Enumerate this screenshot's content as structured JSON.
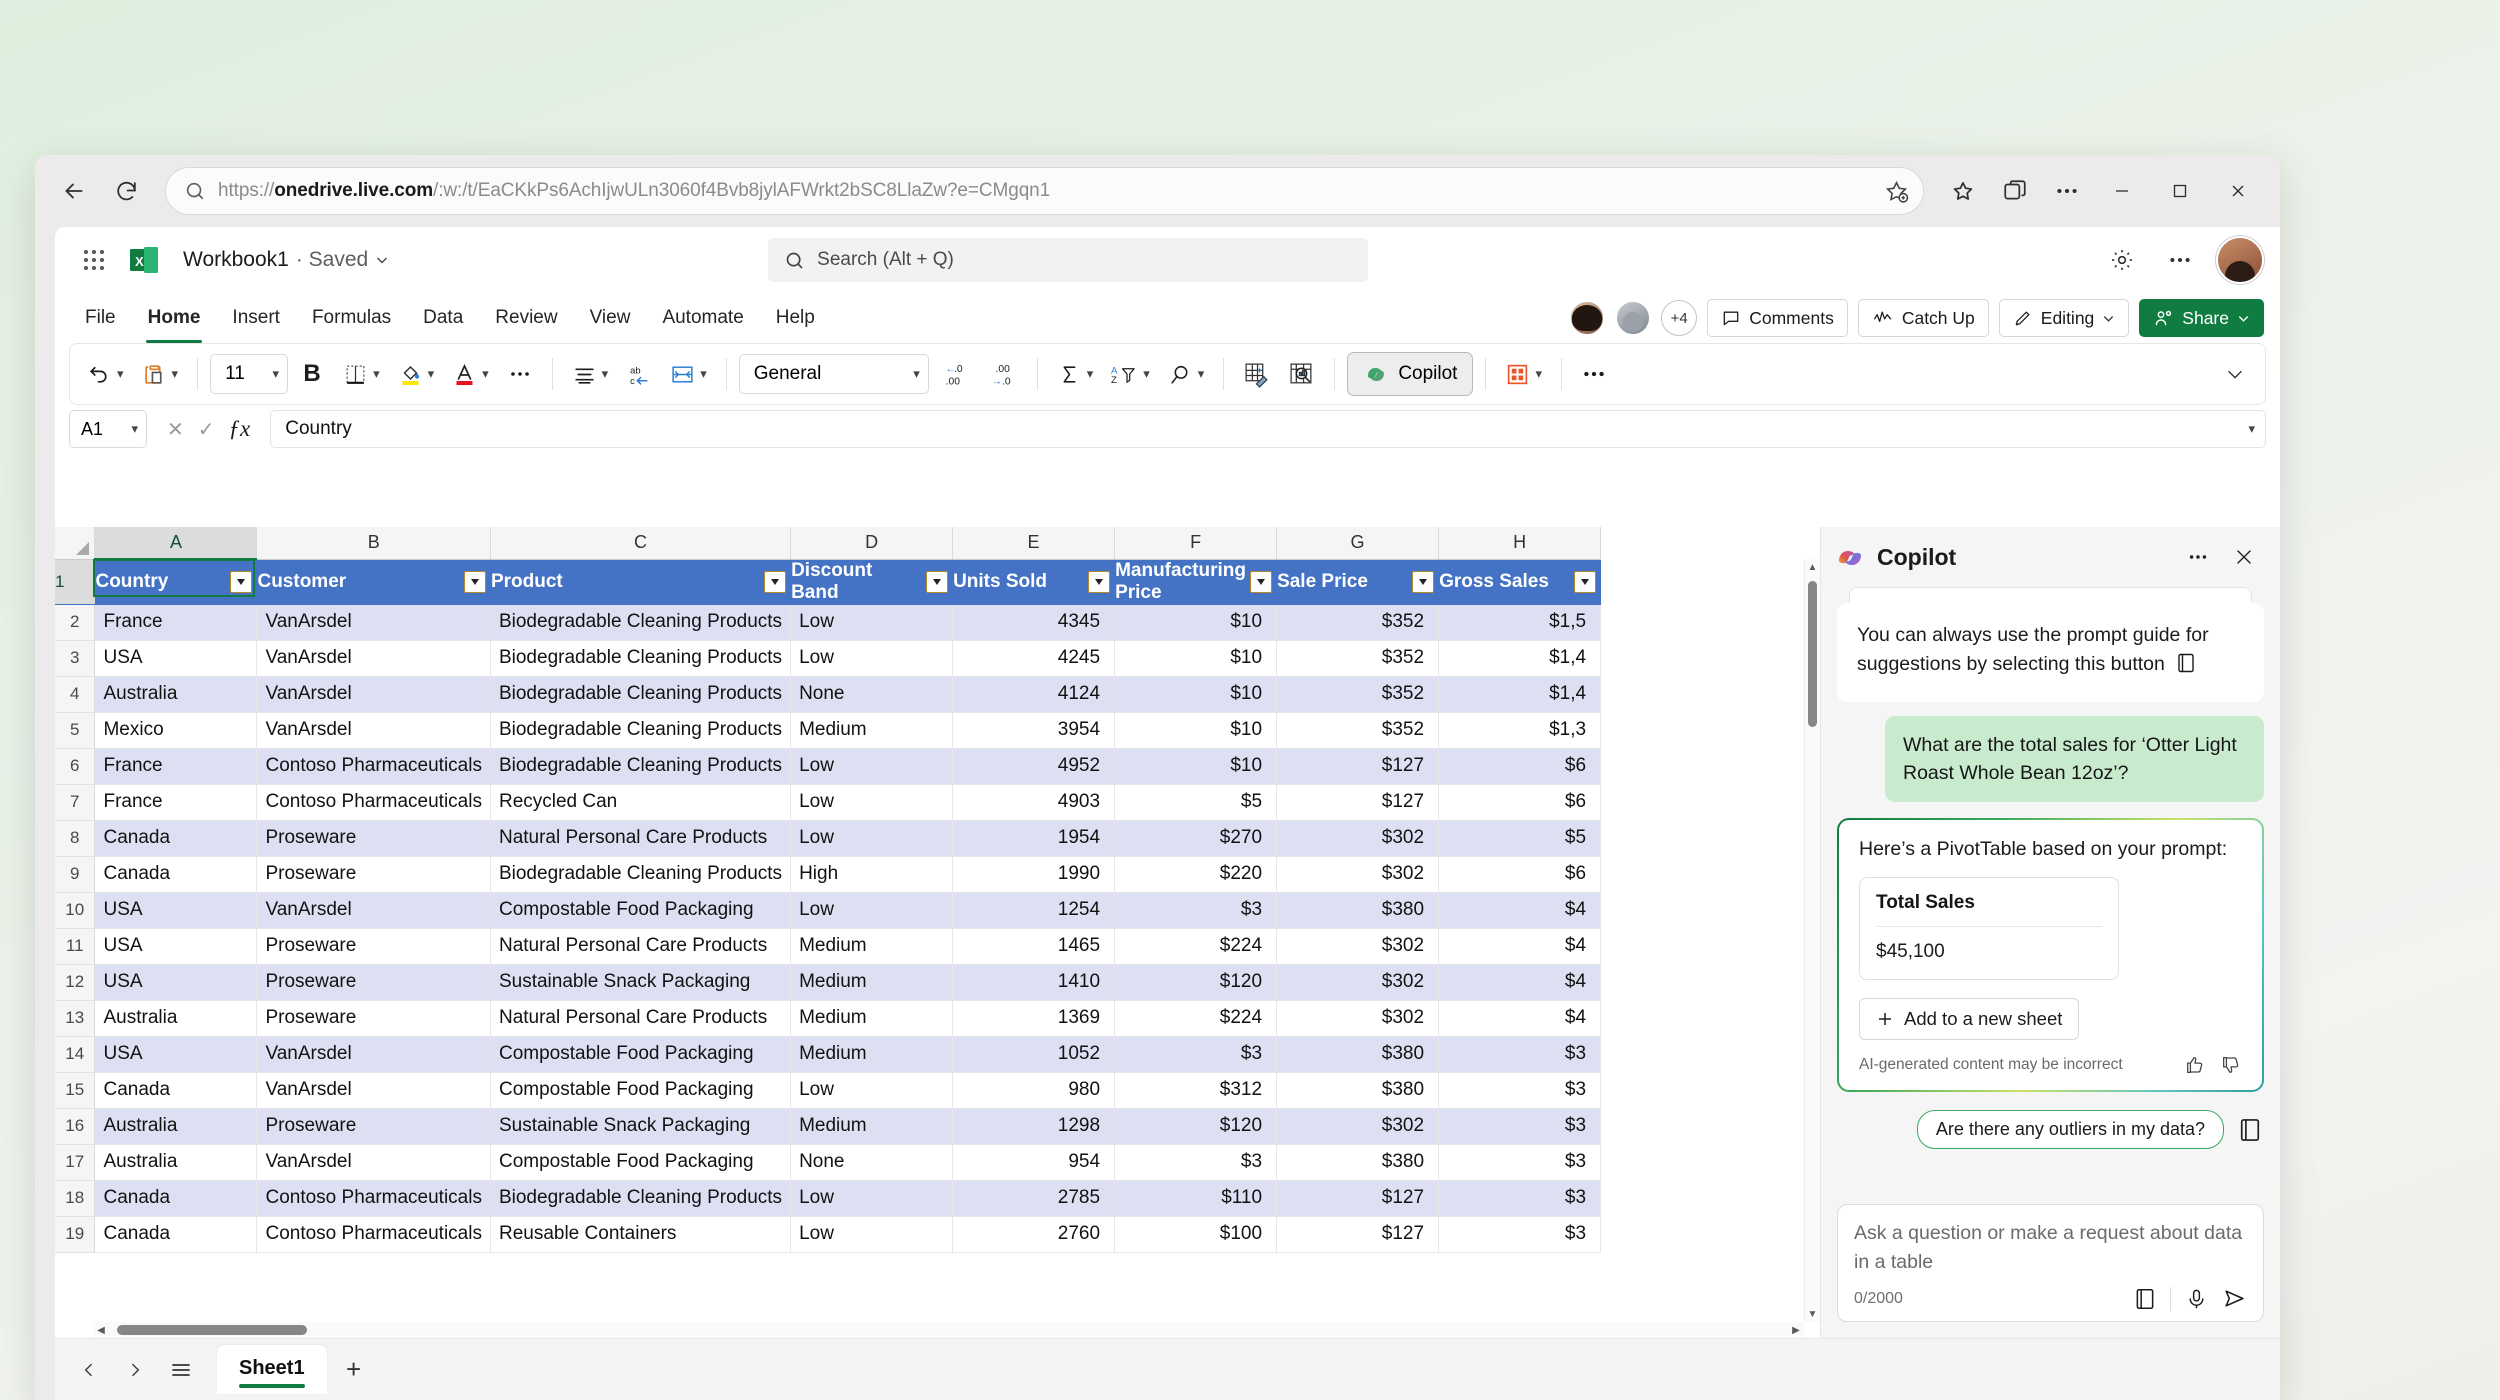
{
  "browser": {
    "url_prefix": "https://",
    "url_domain": "onedrive.live.com",
    "url_path": "/:w:/t/EaCKkPs6AchIjwULn3060f4Bvb8jylAFWrkt2bSC8LlaZw?e=CMgqn1",
    "back_icon": "back-arrow-icon",
    "reload_icon": "reload-icon",
    "search_icon": "search-icon",
    "favorite_icon": "add-favorite-icon",
    "collections_icon": "collections-icon",
    "split_icon": "browser-essentials-icon",
    "more_icon": "more-options-icon",
    "minimize": "–",
    "maximize": "□",
    "close": "✕"
  },
  "app": {
    "waffle": "app-launcher",
    "workbook_name": "Workbook1",
    "saved_status": "· Saved",
    "title_caret": "⌄",
    "search_placeholder": "Search (Alt + Q)",
    "settings_icon": "gear-icon",
    "more_icon": "more-options-icon",
    "avatar": "account-avatar"
  },
  "ribbon": {
    "tabs": [
      {
        "label": "File",
        "active": false
      },
      {
        "label": "Home",
        "active": true
      },
      {
        "label": "Insert",
        "active": false
      },
      {
        "label": "Formulas",
        "active": false
      },
      {
        "label": "Data",
        "active": false
      },
      {
        "label": "Review",
        "active": false
      },
      {
        "label": "View",
        "active": false
      },
      {
        "label": "Automate",
        "active": false
      },
      {
        "label": "Help",
        "active": false
      }
    ],
    "collab_overflow": "+4",
    "comments_label": "Comments",
    "catchup_label": "Catch Up",
    "editing_label": "Editing",
    "share_label": "Share",
    "font_size": "11",
    "bold_label": "B",
    "number_format": "General",
    "copilot_label": "Copilot",
    "collapse_icon": "chevron-down-icon"
  },
  "formula_bar": {
    "name_box": "A1",
    "cancel_icon": "cancel-icon",
    "confirm_icon": "confirm-icon",
    "fx_icon": "fx",
    "value": "Country",
    "expand_icon": "chevron-down-icon"
  },
  "grid": {
    "columns": [
      "A",
      "B",
      "C",
      "D",
      "E",
      "F",
      "G",
      "H"
    ],
    "selected_column": "A",
    "selected_row": "1",
    "headers": [
      "Country",
      "Customer",
      "Product",
      "Discount Band",
      "Units Sold",
      "Manufacturing Price",
      "Sale Price",
      "Gross Sales"
    ],
    "rows": [
      {
        "n": "2",
        "cells": [
          "France",
          "VanArsdel",
          "Biodegradable Cleaning Products",
          "Low",
          "4345",
          "$10",
          "$352",
          "$1,5"
        ]
      },
      {
        "n": "3",
        "cells": [
          "USA",
          "VanArsdel",
          "Biodegradable Cleaning Products",
          "Low",
          "4245",
          "$10",
          "$352",
          "$1,4"
        ]
      },
      {
        "n": "4",
        "cells": [
          "Australia",
          "VanArsdel",
          "Biodegradable Cleaning Products",
          "None",
          "4124",
          "$10",
          "$352",
          "$1,4"
        ]
      },
      {
        "n": "5",
        "cells": [
          "Mexico",
          "VanArsdel",
          "Biodegradable Cleaning Products",
          "Medium",
          "3954",
          "$10",
          "$352",
          "$1,3"
        ]
      },
      {
        "n": "6",
        "cells": [
          "France",
          "Contoso Pharmaceuticals",
          "Biodegradable Cleaning Products",
          "Low",
          "4952",
          "$10",
          "$127",
          "$6"
        ]
      },
      {
        "n": "7",
        "cells": [
          "France",
          "Contoso Pharmaceuticals",
          "Recycled Can",
          "Low",
          "4903",
          "$5",
          "$127",
          "$6"
        ]
      },
      {
        "n": "8",
        "cells": [
          "Canada",
          "Proseware",
          "Natural Personal Care Products",
          "Low",
          "1954",
          "$270",
          "$302",
          "$5"
        ]
      },
      {
        "n": "9",
        "cells": [
          "Canada",
          "Proseware",
          "Biodegradable Cleaning Products",
          "High",
          "1990",
          "$220",
          "$302",
          "$6"
        ]
      },
      {
        "n": "10",
        "cells": [
          "USA",
          "VanArsdel",
          "Compostable Food Packaging",
          "Low",
          "1254",
          "$3",
          "$380",
          "$4"
        ]
      },
      {
        "n": "11",
        "cells": [
          "USA",
          "Proseware",
          "Natural Personal Care Products",
          "Medium",
          "1465",
          "$224",
          "$302",
          "$4"
        ]
      },
      {
        "n": "12",
        "cells": [
          "USA",
          "Proseware",
          "Sustainable Snack Packaging",
          "Medium",
          "1410",
          "$120",
          "$302",
          "$4"
        ]
      },
      {
        "n": "13",
        "cells": [
          "Australia",
          "Proseware",
          "Natural Personal Care Products",
          "Medium",
          "1369",
          "$224",
          "$302",
          "$4"
        ]
      },
      {
        "n": "14",
        "cells": [
          "USA",
          "VanArsdel",
          "Compostable Food Packaging",
          "Medium",
          "1052",
          "$3",
          "$380",
          "$3"
        ]
      },
      {
        "n": "15",
        "cells": [
          "Canada",
          "VanArsdel",
          "Compostable Food Packaging",
          "Low",
          "980",
          "$312",
          "$380",
          "$3"
        ]
      },
      {
        "n": "16",
        "cells": [
          "Australia",
          "Proseware",
          "Sustainable Snack Packaging",
          "Medium",
          "1298",
          "$120",
          "$302",
          "$3"
        ]
      },
      {
        "n": "17",
        "cells": [
          "Australia",
          "VanArsdel",
          "Compostable Food Packaging",
          "None",
          "954",
          "$3",
          "$380",
          "$3"
        ]
      },
      {
        "n": "18",
        "cells": [
          "Canada",
          "Contoso Pharmaceuticals",
          "Biodegradable Cleaning Products",
          "Low",
          "2785",
          "$110",
          "$127",
          "$3"
        ]
      },
      {
        "n": "19",
        "cells": [
          "Canada",
          "Contoso Pharmaceuticals",
          "Reusable Containers",
          "Low",
          "2760",
          "$100",
          "$127",
          "$3"
        ]
      }
    ]
  },
  "copilot": {
    "title": "Copilot",
    "logo_icon": "copilot-icon",
    "more_icon": "more-options-icon",
    "close_icon": "close-icon",
    "intro_text": "You can always use the prompt guide for suggestions by selecting this button",
    "prompt_guide_icon": "prompt-guide-icon",
    "user_message": "What are the total sales for ‘Otter Light Roast Whole Bean 12oz’?",
    "answer_title": "Here’s a PivotTable based on your prompt:",
    "pivot_label": "Total Sales",
    "pivot_value": "$45,100",
    "add_sheet_label": "Add to a new sheet",
    "add_icon": "plus-icon",
    "ai_disclaimer": "AI-generated content may be incorrect",
    "thumbs_up_icon": "thumbs-up-icon",
    "thumbs_down_icon": "thumbs-down-icon",
    "suggestion_chip": "Are there any outliers in my data?",
    "compose_placeholder": "Ask a question or make a request about data in a table",
    "char_count": "0/2000",
    "mic_icon": "microphone-icon",
    "send_icon": "send-icon"
  },
  "sheetbar": {
    "prev_icon": "chevron-left-icon",
    "next_icon": "chevron-right-icon",
    "list_icon": "all-sheets-icon",
    "active_sheet": "Sheet1",
    "add_label": "+"
  },
  "colors": {
    "brand_green": "#107c41",
    "table_header_blue": "#4472c4",
    "band_row": "#dce0f2",
    "copilot_user_bubble": "#c8eacd"
  }
}
